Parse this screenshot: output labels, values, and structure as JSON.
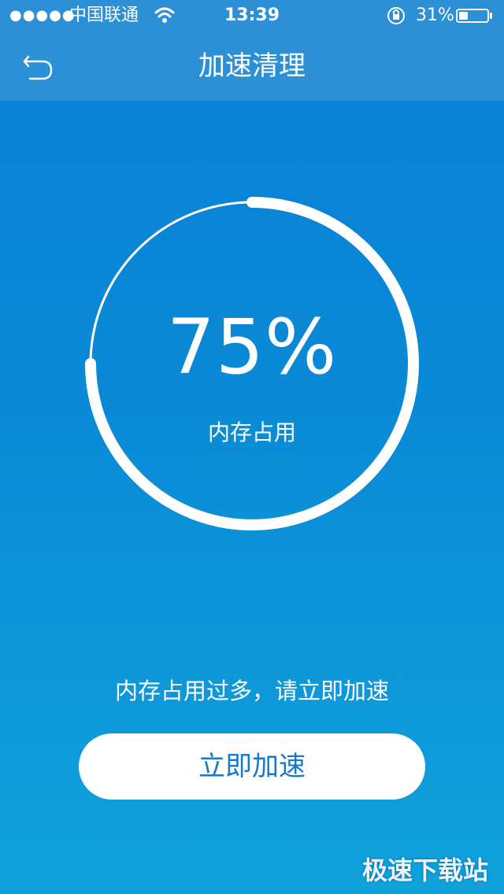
{
  "status_bar": {
    "signal": "●●●●●",
    "carrier": "中国联通",
    "wifi_icon": "wifi-icon",
    "time": "13:39",
    "lock_icon": "rotation-lock-icon",
    "battery_percent": "31%",
    "battery_level": 0.31
  },
  "nav": {
    "back_icon": "back-arrow-icon",
    "title": "加速清理"
  },
  "gauge": {
    "percent_text": "75%",
    "value": 0.75,
    "label": "内存占用"
  },
  "hint": "内存占用过多，请立即加速",
  "action_button": "立即加速",
  "watermark": "极速下载站",
  "colors": {
    "background_top": "#0a7fd6",
    "background_bottom": "#10a2db",
    "nav_bar": "#2b90d6",
    "button_text": "#1a77c9"
  }
}
